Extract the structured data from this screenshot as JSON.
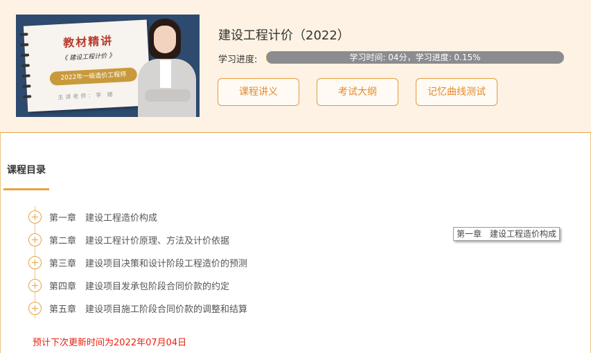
{
  "course": {
    "title": "建设工程计价（2022）",
    "cover": {
      "headline": "教材精讲",
      "subject": "《 建设工程计价 》",
      "badge": "2022年一级造价工程师",
      "lecturer": "主讲老师：李 娜"
    },
    "progress": {
      "label": "学习进度:",
      "text": "学习时间: 04分，学习进度: 0.15%",
      "percent": 0.15
    },
    "buttons": {
      "notes": "课程讲义",
      "syllabus": "考试大纲",
      "memory_test": "记忆曲线测试"
    }
  },
  "catalog": {
    "title": "课程目录",
    "chapters": [
      {
        "num": "第一章",
        "name": "建设工程造价构成"
      },
      {
        "num": "第二章",
        "name": "建设工程计价原理、方法及计价依据"
      },
      {
        "num": "第三章",
        "name": "建设项目决策和设计阶段工程造价的预测"
      },
      {
        "num": "第四章",
        "name": "建设项目发承包阶段合同价款的约定"
      },
      {
        "num": "第五章",
        "name": "建设项目施工阶段合同价款的调整和结算"
      }
    ],
    "tooltip": "第一章　建设工程造价构成",
    "update_note": "预计下次更新时间为2022年07月04日"
  },
  "colors": {
    "accent": "#e8a13c",
    "header_bg": "#fdf2e3",
    "progress_track": "#8a8c8f",
    "update_note": "#e8200f"
  }
}
